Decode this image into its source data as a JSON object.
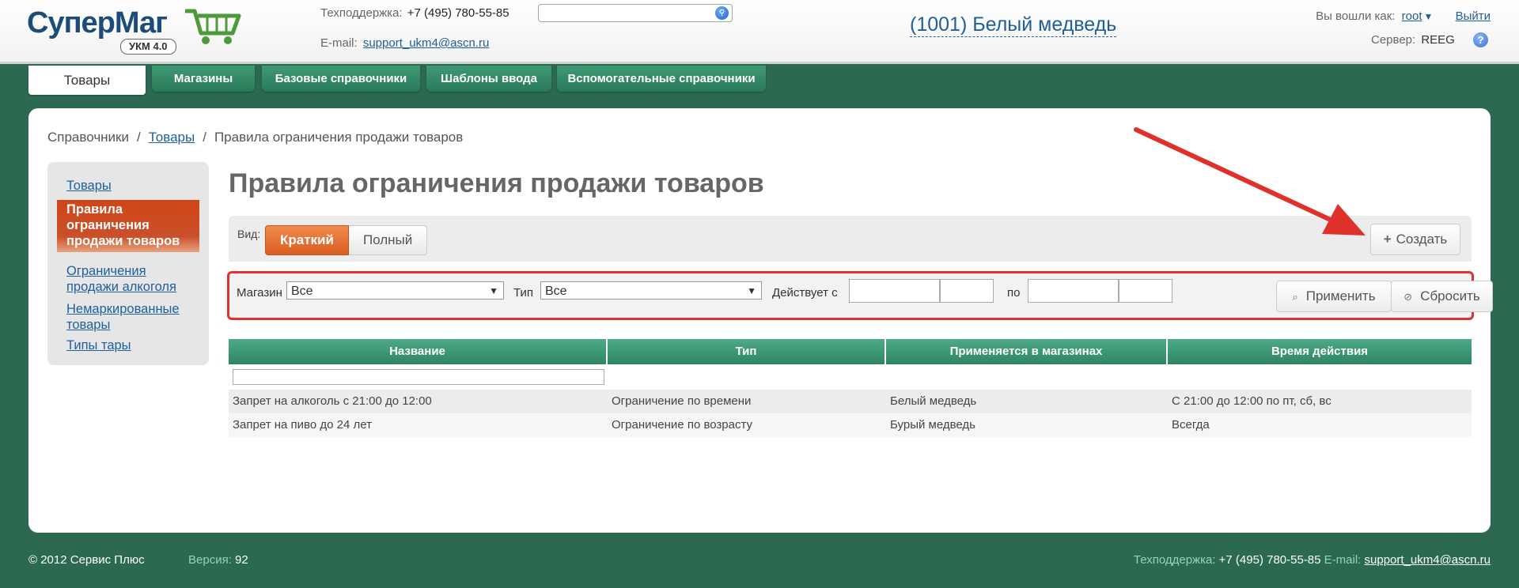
{
  "header": {
    "logo_text": "СуперМаг",
    "logo_badge": "УКМ 4.0",
    "support_label": "Техподдержка:",
    "support_phone": "+7 (495) 780-55-85",
    "email_label": "E-mail:",
    "email": "support_ukm4@ascn.ru",
    "search_placeholder": "",
    "store_name": "(1001) Белый медведь",
    "logged_in_label": "Вы вошли как:",
    "username": "root",
    "logout": "Выйти",
    "server_label": "Сервер:",
    "server_name": "REEG",
    "help": "?"
  },
  "tabs": [
    "Товары",
    "Магазины",
    "Базовые справочники",
    "Шаблоны ввода",
    "Вспомогательные справочники"
  ],
  "breadcrumb": {
    "root": "Справочники",
    "section": "Товары",
    "current": "Правила ограничения продажи товаров",
    "sep": "/"
  },
  "sidebar": {
    "items": [
      "Товары",
      "Правила ограничения продажи товаров",
      "Ограничения продажи алкоголя",
      "Немаркированные товары",
      "Типы тары"
    ]
  },
  "page_title": "Правила ограничения продажи товаров",
  "toolbar": {
    "view_label": "Вид:",
    "view_short": "Краткий",
    "view_full": "Полный",
    "create": "Создать"
  },
  "filter": {
    "store_label": "Магазин",
    "store_value": "Все",
    "type_label": "Тип",
    "type_value": "Все",
    "valid_from_label": "Действует с",
    "valid_to_label": "по",
    "apply": "Применить",
    "reset": "Сбросить"
  },
  "table": {
    "columns": [
      "Название",
      "Тип",
      "Применяется в магазинах",
      "Время действия"
    ],
    "rows": [
      [
        "Запрет на алкоголь с 21:00 до 12:00",
        "Ограничение по времени",
        "Белый медведь",
        "С 21:00 до 12:00 по пт, сб, вс"
      ],
      [
        "Запрет на пиво до 24 лет",
        "Ограничение по возрасту",
        "Бурый медведь",
        "Всегда"
      ]
    ]
  },
  "footer": {
    "copyright": "© 2012 Сервис Плюс",
    "version_label": "Версия:",
    "version": "92",
    "support_label": "Техподдержка:",
    "support_phone": "+7 (495) 780-55-85",
    "email_label": "E-mail:",
    "email": "support_ukm4@ascn.ru"
  },
  "colors": {
    "brand_green": "#2b6a50",
    "accent_orange": "#db5e22",
    "highlight_red": "#e03030",
    "link_blue": "#1f5f9a"
  }
}
